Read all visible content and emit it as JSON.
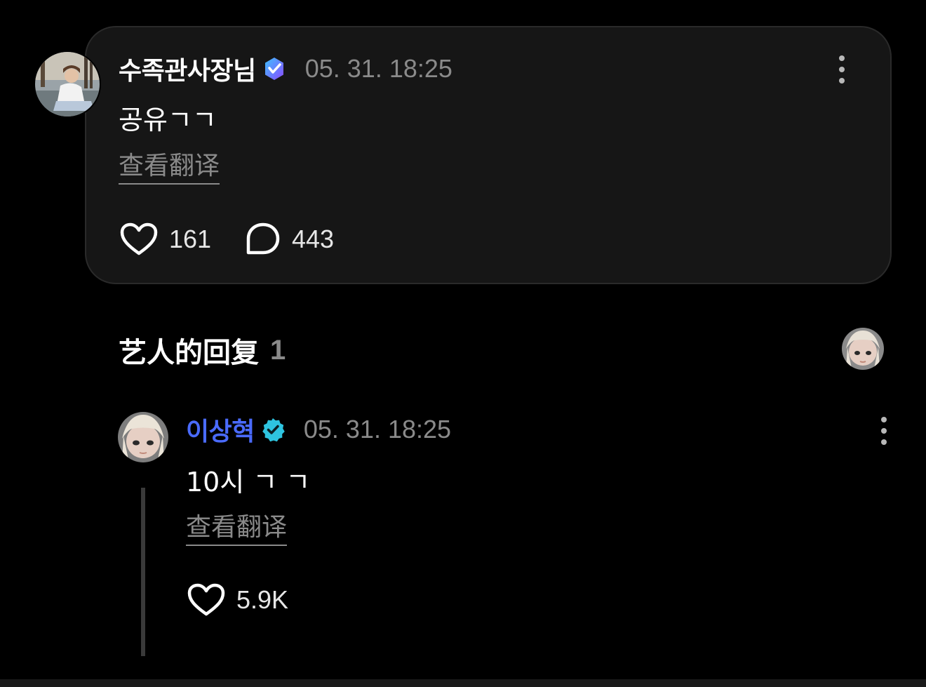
{
  "post": {
    "username": "수족관사장님",
    "timestamp": "05. 31. 18:25",
    "body": "공유ㄱㄱ",
    "translate_label": "查看翻译",
    "likes": "161",
    "comments": "443",
    "badge_color": "#6c5ce7"
  },
  "artist_replies": {
    "title": "艺人的回复",
    "count": "1"
  },
  "reply": {
    "username": "이상혁",
    "timestamp": "05. 31. 18:25",
    "body": "10시 ㄱ ㄱ",
    "translate_label": "查看翻译",
    "likes": "5.9K",
    "username_color": "#4a6bff",
    "badge_color": "#2ec4e0"
  }
}
